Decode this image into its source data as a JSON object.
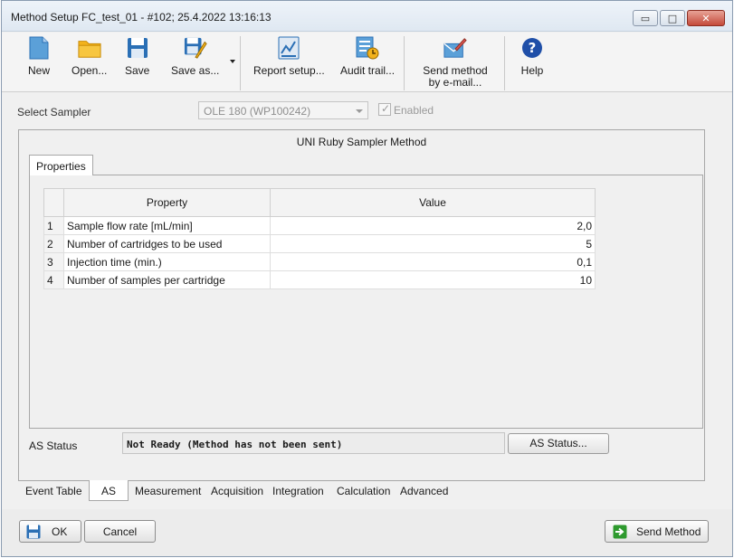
{
  "window": {
    "title": "Method Setup FC_test_01 - #102;  25.4.2022  13:16:13",
    "controls": {
      "minimize": "▭",
      "maximize": "□",
      "close": "✕"
    }
  },
  "toolbar": {
    "items": [
      {
        "label": "New",
        "icon": "new-file-icon"
      },
      {
        "label": "Open...",
        "icon": "folder-icon"
      },
      {
        "label": "Save",
        "icon": "save-icon"
      },
      {
        "label": "Save as...",
        "icon": "save-as-icon"
      },
      {
        "label": "Report setup...",
        "icon": "report-icon"
      },
      {
        "label": "Audit trail...",
        "icon": "audit-trail-icon"
      },
      {
        "label": "Send method by e-mail...",
        "icon": "email-icon"
      },
      {
        "label": "Help",
        "icon": "help-icon"
      }
    ]
  },
  "sampler": {
    "label": "Select Sampler",
    "selected": "OLE 180 (WP100242)",
    "enabled_label": "Enabled",
    "enabled_checked": true
  },
  "method": {
    "title": "UNI Ruby Sampler Method",
    "tab_label": "Properties",
    "columns": [
      "Property",
      "Value"
    ],
    "rows": [
      {
        "num": "1",
        "property": "Sample flow rate [mL/min]",
        "value": "2,0"
      },
      {
        "num": "2",
        "property": "Number of cartridges to be used",
        "value": "5"
      },
      {
        "num": "3",
        "property": "Injection time (min.)",
        "value": "0,1"
      },
      {
        "num": "4",
        "property": "Number of samples per cartridge",
        "value": "10"
      }
    ]
  },
  "as_status": {
    "label": "AS Status",
    "value": "Not Ready (Method has not been sent)",
    "button": "AS Status..."
  },
  "bottom_tabs": [
    "Event Table",
    "AS",
    "Measurement",
    "Acquisition",
    "Integration",
    "Calculation",
    "Advanced"
  ],
  "active_tab": "AS",
  "footer": {
    "ok": "OK",
    "cancel": "Cancel",
    "send": "Send Method"
  },
  "colors": {
    "icon_blue": "#2a6fb5",
    "icon_yellow": "#f2b21c",
    "help_blue": "#1f4fa8",
    "send_green": "#2e9a2e"
  }
}
